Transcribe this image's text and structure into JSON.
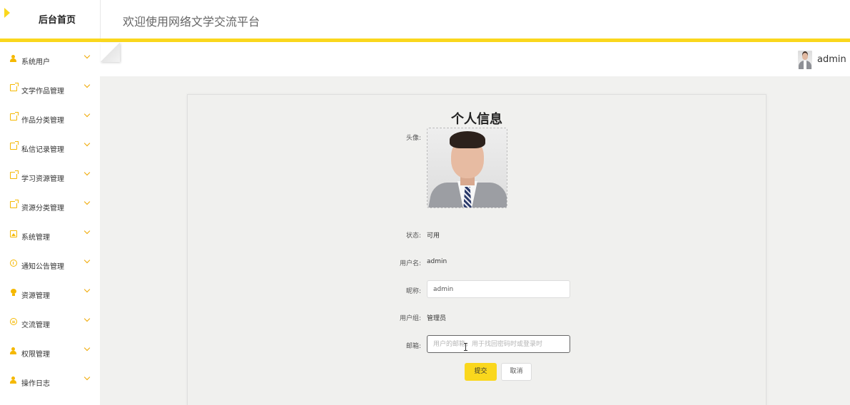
{
  "header": {
    "brand": "后台首页",
    "welcome": "欢迎使用网络文学交流平台"
  },
  "colors": {
    "accent": "#fad71d",
    "icon": "#f5b800"
  },
  "sidebar": {
    "items": [
      {
        "label": "系统用户",
        "icon": "user-icon"
      },
      {
        "label": "文学作品管理",
        "icon": "share-icon"
      },
      {
        "label": "作品分类管理",
        "icon": "share-icon"
      },
      {
        "label": "私信记录管理",
        "icon": "share-icon"
      },
      {
        "label": "学习资源管理",
        "icon": "share-icon"
      },
      {
        "label": "资源分类管理",
        "icon": "share-icon"
      },
      {
        "label": "系统管理",
        "icon": "image-icon"
      },
      {
        "label": "通知公告管理",
        "icon": "info-icon"
      },
      {
        "label": "资源管理",
        "icon": "bulb-icon"
      },
      {
        "label": "交流管理",
        "icon": "chat-icon"
      },
      {
        "label": "权限管理",
        "icon": "user-icon"
      },
      {
        "label": "操作日志",
        "icon": "user-icon"
      }
    ]
  },
  "user_menu": {
    "name": "admin"
  },
  "profile": {
    "title": "个人信息",
    "avatar_label": "头像:",
    "status_label": "状态:",
    "status_value": "可用",
    "username_label": "用户名:",
    "username_value": "admin",
    "nickname_label": "昵称:",
    "nickname_value": "admin",
    "group_label": "用户组:",
    "group_value": "管理员",
    "email_label": "邮箱:",
    "email_value": "",
    "email_placeholder": "用户的邮箱，用于找回密码时或登录时",
    "submit_label": "提交",
    "cancel_label": "取消"
  }
}
